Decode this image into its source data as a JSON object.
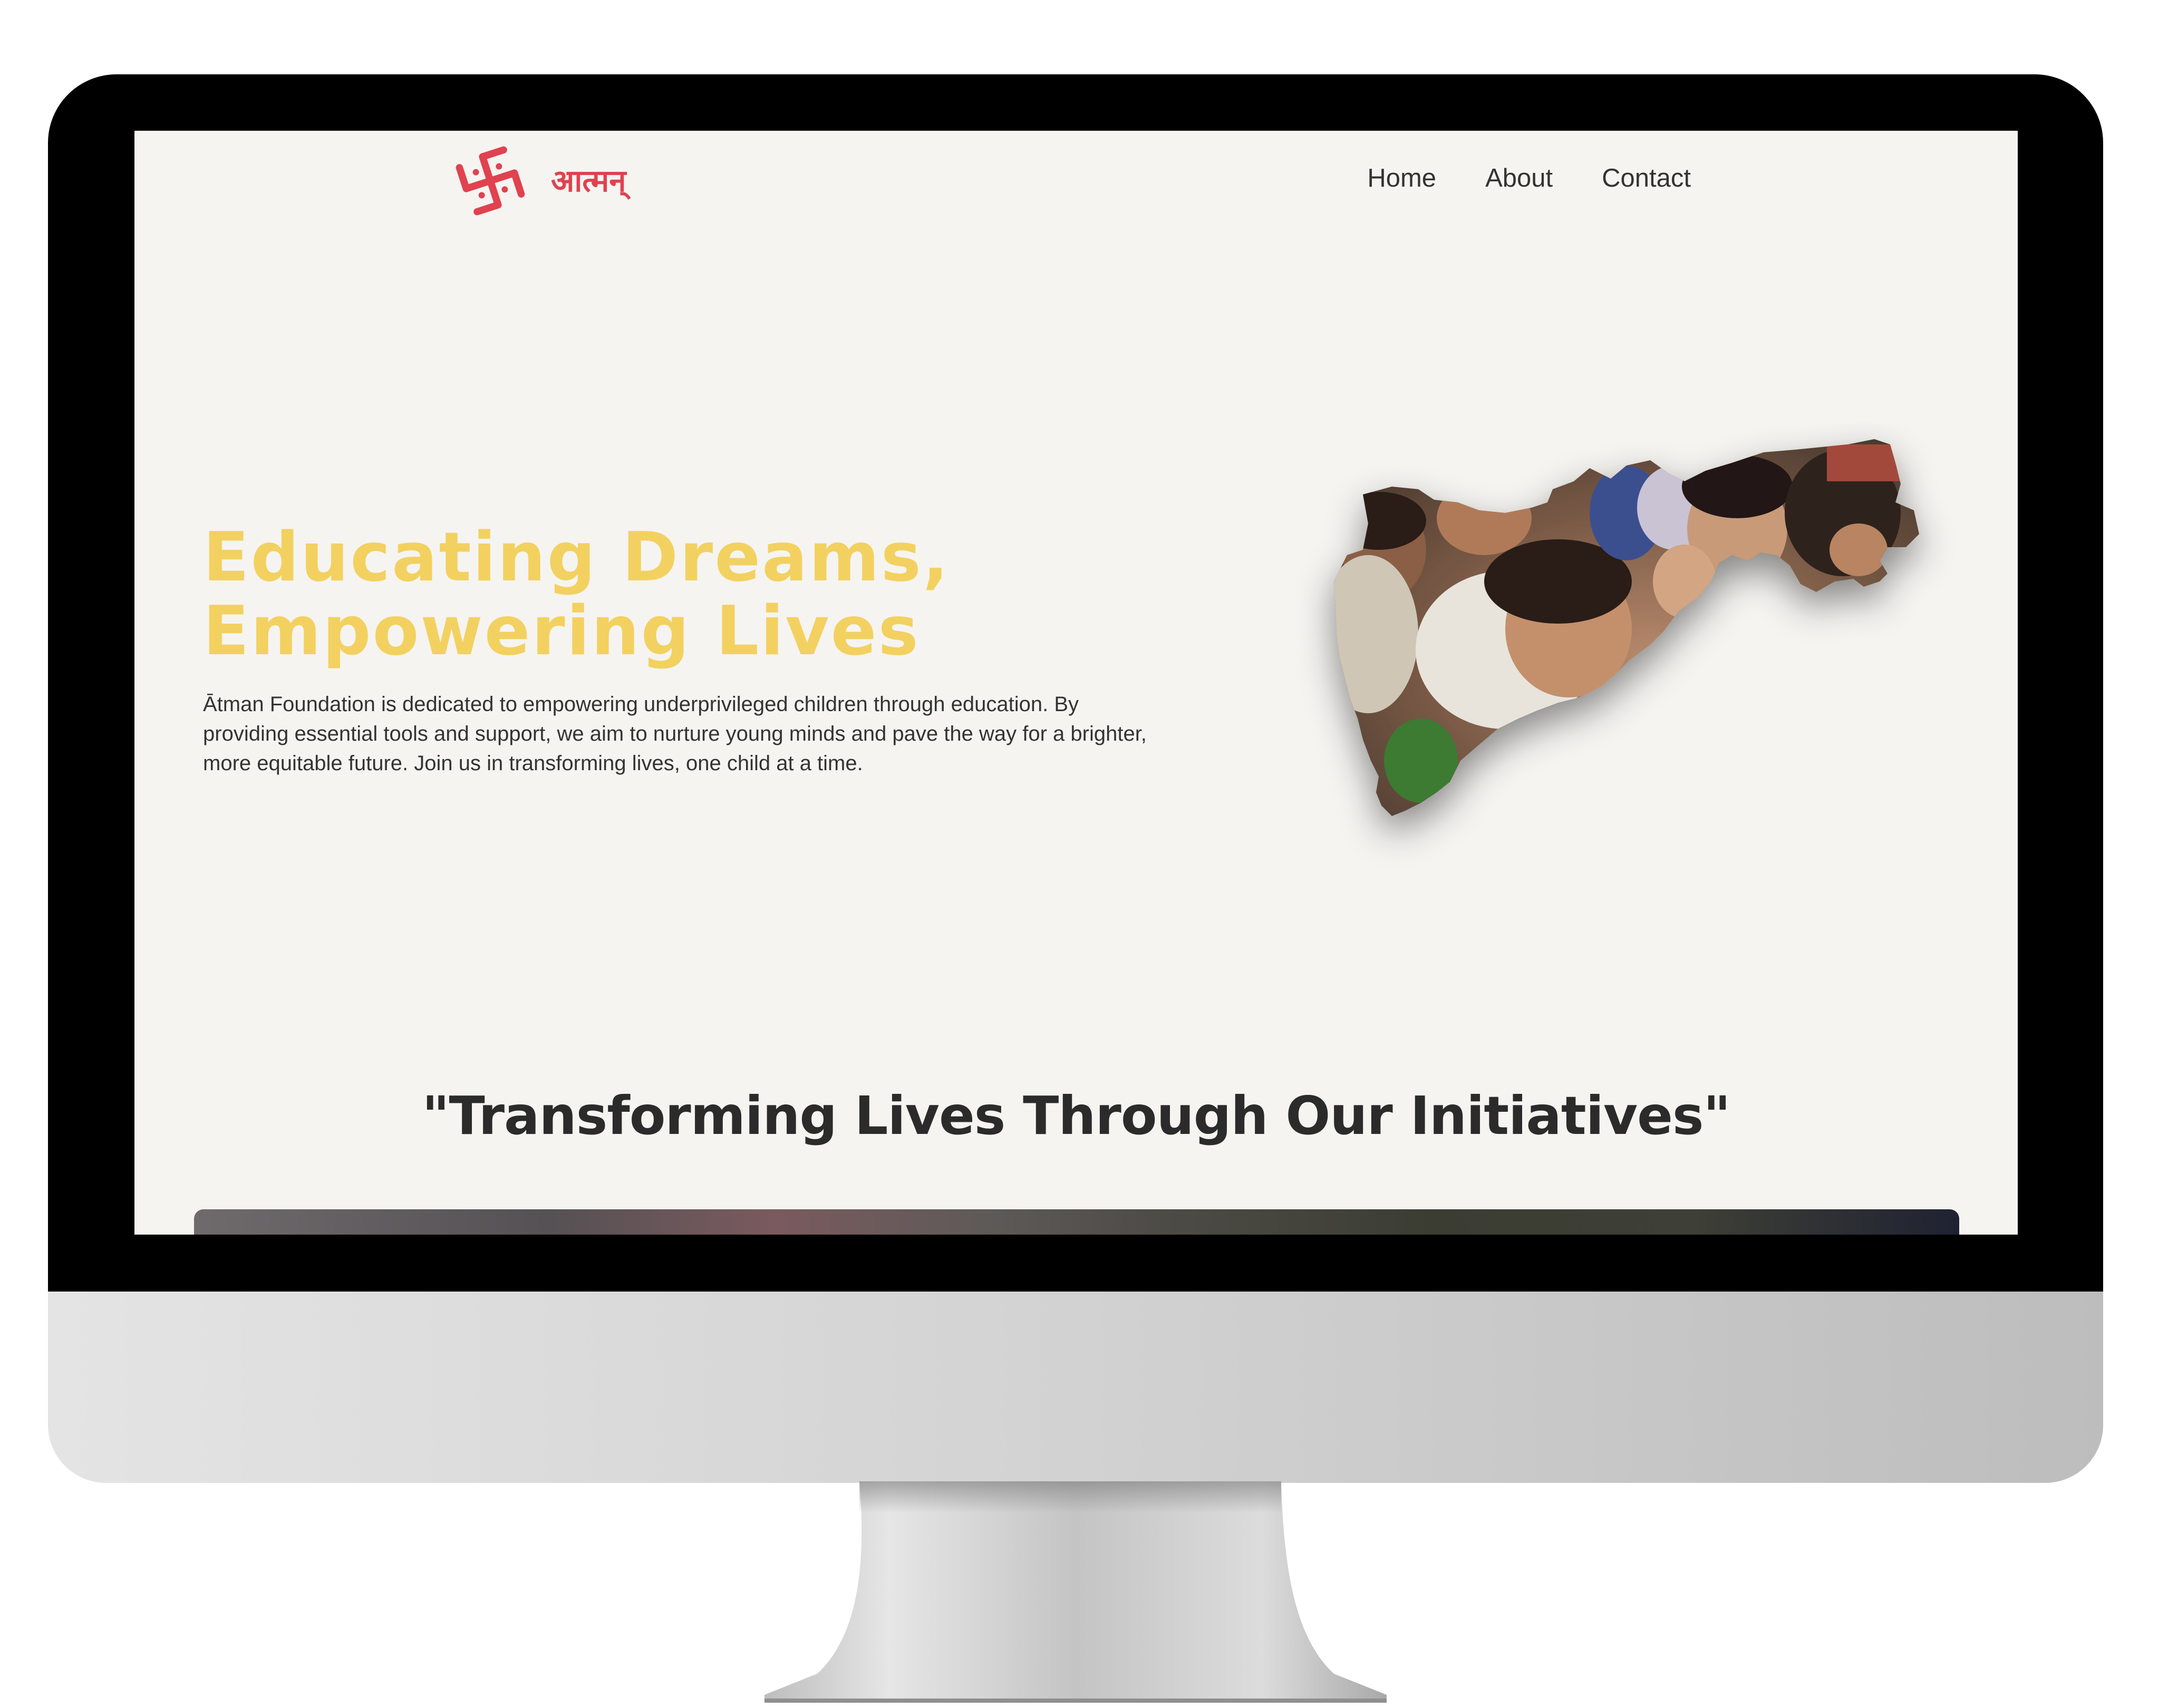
{
  "logo": {
    "symbol": "swastika-icon",
    "text": "आत्मन्",
    "color": "#e0424f"
  },
  "nav": {
    "items": [
      {
        "label": "Home"
      },
      {
        "label": "About"
      },
      {
        "label": "Contact"
      }
    ]
  },
  "hero": {
    "title_line1": "Educating Dreams,",
    "title_line2": "Empowering Lives",
    "title_color": "#f3d160",
    "body": "Ātman Foundation is dedicated to empowering underprivileged children through education. By providing essential tools and support, we aim to nurture young minds and pave the way for a brighter, more equitable future. Join us in transforming lives, one child at a time.",
    "image": "children-photo-map-shaped"
  },
  "initiatives": {
    "title": "\"Transforming Lives Through Our Initiatives\""
  },
  "colors": {
    "background": "#f5f4f1",
    "text": "#333333",
    "heading": "#2b2b2b",
    "accent_red": "#e0424f",
    "accent_yellow": "#f3d160"
  }
}
